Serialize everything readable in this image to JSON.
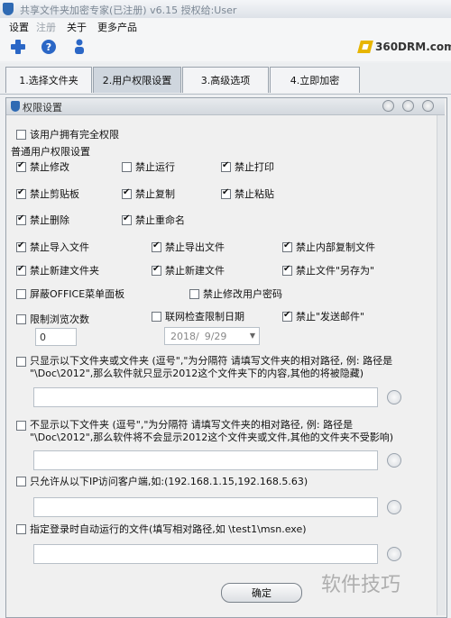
{
  "window": {
    "title": "共享文件夹加密专家(已注册) v6.15  授权给:User"
  },
  "menu": [
    "设置",
    "注册",
    "关于",
    "更多产品"
  ],
  "toolbar": {
    "icons": [
      "add-icon",
      "help-icon",
      "person-icon"
    ],
    "logo": "360DRM.com"
  },
  "tabs": [
    "1.选择文件夹",
    "2.用户权限设置",
    "3.高级选项",
    "4.立即加密"
  ],
  "dialog": {
    "title": "权限设置",
    "full_perm": {
      "label": "该用户拥有完全权限",
      "checked": false
    },
    "section": "普通用户权限设置",
    "row1": [
      {
        "label": "禁止修改",
        "checked": true
      },
      {
        "label": "禁止运行",
        "checked": false
      },
      {
        "label": "禁止打印",
        "checked": true
      }
    ],
    "row2": [
      {
        "label": "禁止剪贴板",
        "checked": true
      },
      {
        "label": "禁止复制",
        "checked": true
      },
      {
        "label": "禁止粘贴",
        "checked": true
      }
    ],
    "row3": [
      {
        "label": "禁止删除",
        "checked": true
      },
      {
        "label": "禁止重命名",
        "checked": true
      }
    ],
    "row4": [
      {
        "label": "禁止导入文件",
        "checked": true
      },
      {
        "label": "禁止导出文件",
        "checked": true
      },
      {
        "label": "禁止内部复制文件",
        "checked": true
      }
    ],
    "row5": [
      {
        "label": "禁止新建文件夹",
        "checked": true
      },
      {
        "label": "禁止新建文件",
        "checked": true
      },
      {
        "label": "禁止文件\"另存为\"",
        "checked": true
      }
    ],
    "row6": [
      {
        "label": "屏蔽OFFICE菜单面板",
        "checked": false
      },
      {
        "label": "禁止修改用户密码",
        "checked": false
      }
    ],
    "row7": [
      {
        "label": "限制浏览次数",
        "checked": false
      },
      {
        "label": "联网检查限制日期",
        "checked": false
      },
      {
        "label": "禁止\"发送邮件\"",
        "checked": true
      }
    ],
    "view_count": "0",
    "date": {
      "year": "2018/",
      "day": "9/29"
    },
    "only_show": {
      "line1": "只显示以下文件夹或文件夹 (逗号\",\"为分隔符 请填写文件夹的相对路径, 例: 路径是",
      "line2": "\"\\Doc\\2012\",那么软件就只显示2012这个文件夹下的内容,其他的将被隐藏)"
    },
    "not_show": {
      "line1": "不显示以下文件夹 (逗号\",\"为分隔符 请填写文件夹的相对路径, 例: 路径是",
      "line2": "\"\\Doc\\2012\",那么软件将不会显示2012这个文件夹或文件,其他的文件夹不受影响)"
    },
    "ip_allow": "只允许从以下IP访问客户端,如:(192.168.1.15,192.168.5.63)",
    "autorun": "指定登录时自动运行的文件(填写相对路径,如 \\test1\\msn.exe)",
    "ok": "确定"
  },
  "watermark": "软件技巧"
}
